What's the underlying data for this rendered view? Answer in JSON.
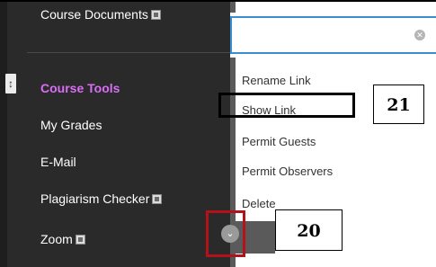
{
  "sidebar": {
    "items": [
      {
        "label": "Course Documents",
        "badge": true
      },
      {
        "label": "Course Tools",
        "heading": true
      },
      {
        "label": "My Grades"
      },
      {
        "label": "E-Mail"
      },
      {
        "label": "Plagiarism Checker",
        "badge": true
      },
      {
        "label": "Zoom",
        "badge": true
      }
    ],
    "handle_icon": "drag-handle-icon",
    "heading_color": "#d96ef5"
  },
  "search": {
    "value": "",
    "placeholder": "",
    "clear_icon": "clear-icon"
  },
  "context_menu": {
    "items": [
      {
        "label": "Rename Link"
      },
      {
        "label": "Show Link",
        "highlighted": true
      },
      {
        "label": "Permit Guests"
      },
      {
        "label": "Permit Observers"
      },
      {
        "label": "Delete"
      }
    ]
  },
  "callouts": {
    "show_link": "21",
    "chevron": "20"
  },
  "colors": {
    "accent": "#3a8fd0",
    "callout_red": "#b3121a"
  }
}
